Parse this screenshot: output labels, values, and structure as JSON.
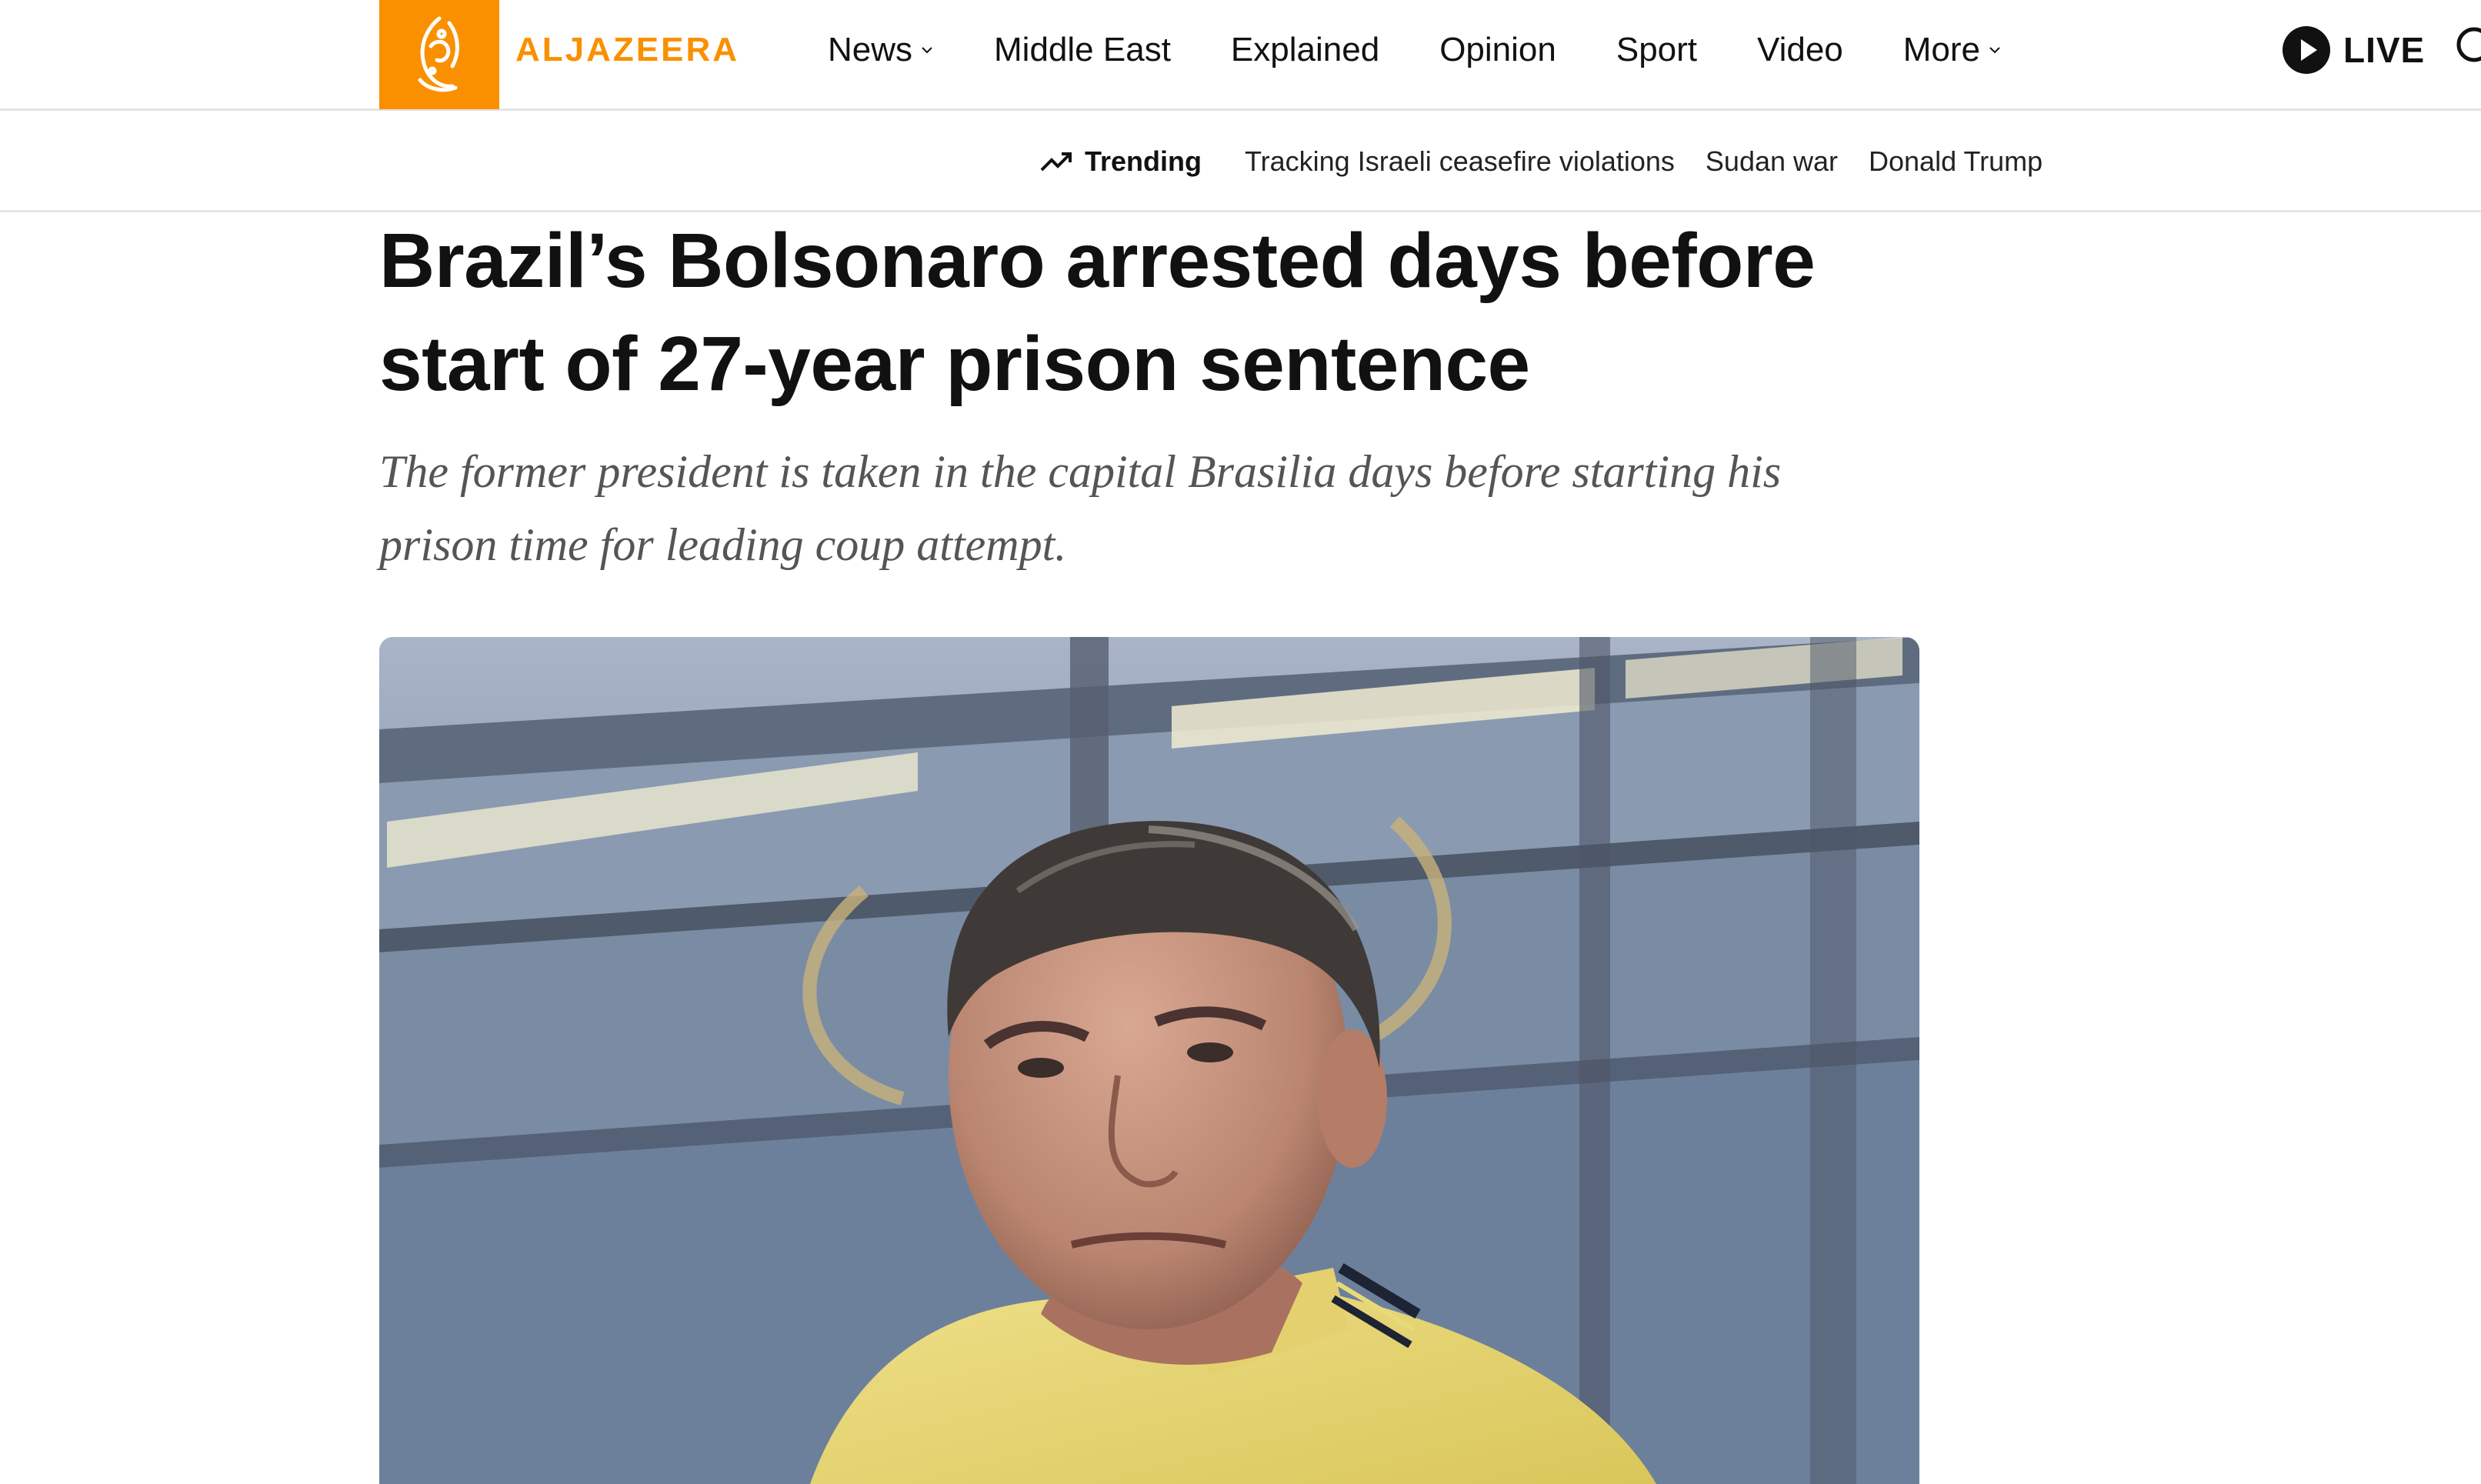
{
  "site": {
    "brand": "ALJAZEERA",
    "brand_color": "#fa9000"
  },
  "nav": {
    "items": [
      {
        "label": "News",
        "has_dropdown": true
      },
      {
        "label": "Middle East",
        "has_dropdown": false
      },
      {
        "label": "Explained",
        "has_dropdown": false
      },
      {
        "label": "Opinion",
        "has_dropdown": false
      },
      {
        "label": "Sport",
        "has_dropdown": false
      },
      {
        "label": "Video",
        "has_dropdown": false
      },
      {
        "label": "More",
        "has_dropdown": true
      }
    ],
    "live_label": "LIVE"
  },
  "trending": {
    "label": "Trending",
    "links": [
      "Tracking Israeli ceasefire violations",
      "Sudan war",
      "Donald Trump"
    ]
  },
  "article": {
    "headline": "Brazil’s Bolsonaro arrested days before start of 27-year prison sentence",
    "standfirst": "The former president is taken in the capital Brasilia days before starting his prison time for leading coup attempt."
  },
  "icons": {
    "logo": "aljazeera-logo-icon",
    "chevron": "chevron-down-icon",
    "live": "play-circle-icon",
    "search": "search-icon",
    "trending": "trending-up-icon"
  }
}
